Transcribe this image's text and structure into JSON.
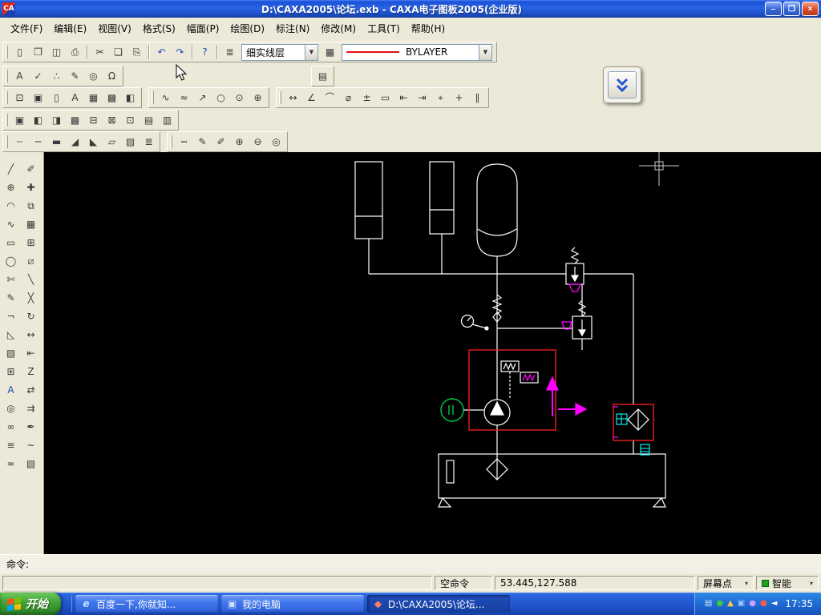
{
  "window": {
    "title": "D:\\CAXA2005\\论坛.exb - CAXA电子图板2005(企业版)",
    "app_initials": "CA"
  },
  "glyphs": {
    "combo_arrow": "▼",
    "dropdown": "▾",
    "minimize": "–",
    "maximize": "❐",
    "close": "×"
  },
  "menu": [
    {
      "id": "file",
      "label": "文件(F)"
    },
    {
      "id": "edit",
      "label": "编辑(E)"
    },
    {
      "id": "view",
      "label": "视图(V)"
    },
    {
      "id": "format",
      "label": "格式(S)"
    },
    {
      "id": "paper",
      "label": "幅面(P)"
    },
    {
      "id": "draw",
      "label": "绘图(D)"
    },
    {
      "id": "dimension",
      "label": "标注(N)"
    },
    {
      "id": "modify",
      "label": "修改(M)"
    },
    {
      "id": "tools",
      "label": "工具(T)"
    },
    {
      "id": "help",
      "label": "帮助(H)"
    }
  ],
  "toolbars": {
    "standard": [
      {
        "n": "new-file",
        "g": "▯"
      },
      {
        "n": "open-file",
        "g": "❐"
      },
      {
        "n": "save-file",
        "g": "◫"
      },
      {
        "n": "print",
        "g": "⎙"
      },
      "|",
      {
        "n": "cut",
        "g": "✂"
      },
      {
        "n": "copy",
        "g": "❏"
      },
      {
        "n": "paste",
        "g": "⎘"
      },
      "|",
      {
        "n": "undo",
        "g": "↶",
        "c": "#2a52c4"
      },
      {
        "n": "redo",
        "g": "↷",
        "c": "#2a52c4"
      },
      "|",
      {
        "n": "help",
        "g": "?",
        "c": "#1a48c4"
      },
      "|",
      {
        "n": "layer-settings",
        "g": "≣"
      }
    ],
    "layer_combo": "细实线层",
    "color_combo": "BYLAYER",
    "row1_extra": [
      {
        "n": "line-width",
        "g": "▦"
      }
    ],
    "row2": [
      {
        "n": "text-style",
        "g": "A"
      },
      {
        "n": "dimension-style",
        "g": "✓"
      },
      {
        "n": "point-style",
        "g": "∴"
      },
      {
        "n": "style-manager",
        "g": "✎"
      },
      {
        "n": "query",
        "g": "◎"
      },
      {
        "n": "symbols",
        "g": "Ω"
      }
    ],
    "row2_single": [
      {
        "n": "options",
        "g": "▤"
      }
    ],
    "view_group": [
      {
        "n": "zoom-window",
        "g": "⊡"
      },
      {
        "n": "show-image",
        "g": "▣"
      },
      {
        "n": "new-view",
        "g": "▯"
      },
      {
        "n": "text-display",
        "g": "A"
      },
      {
        "n": "table",
        "g": "▦"
      },
      {
        "n": "layer-colors",
        "g": "▩"
      },
      {
        "n": "layout",
        "g": "◧"
      }
    ],
    "draw_group": [
      {
        "n": "spline",
        "g": "∿"
      },
      {
        "n": "sketch",
        "g": "≈"
      },
      {
        "n": "leader",
        "g": "↗"
      },
      {
        "n": "circle",
        "g": "○"
      },
      {
        "n": "point",
        "g": "⊙"
      },
      {
        "n": "center-mark",
        "g": "⊕"
      }
    ],
    "dim_group": [
      {
        "n": "dim-linear",
        "g": "↔"
      },
      {
        "n": "dim-angular",
        "g": "∠"
      },
      {
        "n": "dim-arc",
        "g": "⌒"
      },
      {
        "n": "dim-diameter",
        "g": "⌀"
      },
      {
        "n": "dim-tolerance",
        "g": "±"
      },
      {
        "n": "dim-frame",
        "g": "▭"
      },
      {
        "n": "dim-datum-left",
        "g": "⇤"
      },
      {
        "n": "dim-datum-right",
        "g": "⇥"
      },
      {
        "n": "dim-center",
        "g": "⌖"
      },
      {
        "n": "dim-cross",
        "g": "+"
      },
      {
        "n": "dim-parallel",
        "g": "∥"
      }
    ],
    "block_group": [
      {
        "n": "block-create",
        "g": "▣"
      },
      {
        "n": "block-insert",
        "g": "◧"
      },
      {
        "n": "block-attrib",
        "g": "◨"
      },
      {
        "n": "block-library",
        "g": "▩"
      },
      {
        "n": "block-edit",
        "g": "⊟"
      },
      {
        "n": "block-explode",
        "g": "⊠"
      },
      {
        "n": "ole-object",
        "g": "⊡"
      },
      {
        "n": "image-ref",
        "g": "▤"
      },
      {
        "n": "xref",
        "g": "▥"
      }
    ],
    "style_group": [
      {
        "n": "linetype-dash",
        "g": "┄"
      },
      {
        "n": "linetype-solid",
        "g": "─"
      },
      {
        "n": "line-bold",
        "g": "▬"
      },
      {
        "n": "hatch-left",
        "g": "◢"
      },
      {
        "n": "hatch-right",
        "g": "◣"
      },
      {
        "n": "parallelogram",
        "g": "▱"
      },
      {
        "n": "fill-pattern",
        "g": "▨"
      },
      {
        "n": "line-styles",
        "g": "≣"
      }
    ],
    "edit_group": [
      {
        "n": "dotted-line",
        "g": "┉"
      },
      {
        "n": "edit-pen",
        "g": "✎"
      },
      {
        "n": "edit-pencil",
        "g": "✐"
      },
      {
        "n": "zoom-in",
        "g": "⊕"
      },
      {
        "n": "zoom-out",
        "g": "⊖"
      },
      {
        "n": "inspect",
        "g": "◎"
      }
    ]
  },
  "palette": {
    "col1": [
      {
        "n": "draw-line",
        "g": "╱"
      },
      {
        "n": "draw-circle",
        "g": "⊕"
      },
      {
        "n": "draw-arc",
        "g": "◠"
      },
      {
        "n": "draw-spline",
        "g": "∿"
      },
      {
        "n": "draw-rectangle",
        "g": "▭"
      },
      {
        "n": "draw-ellipse",
        "g": "◯"
      },
      {
        "n": "trim",
        "g": "✄"
      },
      {
        "n": "sketch-pen",
        "g": "✎"
      },
      {
        "n": "break-corner",
        "g": "¬"
      },
      {
        "n": "chamfer",
        "g": "◺"
      },
      {
        "n": "hatch",
        "g": "▨"
      },
      {
        "n": "block-text",
        "g": "⊞"
      },
      {
        "n": "text",
        "g": "A",
        "c": "#1a48c4"
      },
      {
        "n": "inspect-zoom",
        "g": "◎"
      },
      {
        "n": "link",
        "g": "∞"
      },
      {
        "n": "object-list",
        "g": "≡"
      },
      {
        "n": "wave-line",
        "g": "≈"
      }
    ],
    "col2": [
      {
        "n": "edit-color",
        "g": "✐"
      },
      {
        "n": "move",
        "g": "✚"
      },
      {
        "n": "mirror",
        "g": "⧉"
      },
      {
        "n": "array",
        "g": "▦"
      },
      {
        "n": "window-select",
        "g": "⊞"
      },
      {
        "n": "crop",
        "g": "⧄"
      },
      {
        "n": "divide",
        "g": "╲"
      },
      {
        "n": "erase",
        "g": "╳"
      },
      {
        "n": "rotate",
        "g": "↻"
      },
      {
        "n": "stretch",
        "g": "↔"
      },
      {
        "n": "align-left",
        "g": "⇤"
      },
      {
        "n": "zigzag",
        "g": "Z"
      },
      {
        "n": "swap",
        "g": "⇄"
      },
      {
        "n": "offset",
        "g": "⇉"
      },
      {
        "n": "pen-style",
        "g": "✒"
      },
      {
        "n": "connector",
        "g": "~"
      },
      {
        "n": "fill",
        "g": "▧"
      }
    ]
  },
  "command": {
    "label": "命令:"
  },
  "status": {
    "mode": "空命令",
    "coords": "53.445,127.588",
    "pick": "屏幕点",
    "snap": "智能"
  },
  "taskbar": {
    "start": "开始",
    "tasks": [
      {
        "label": "百度一下,你就知...",
        "icon": "e",
        "icon_color": "#bfe6ff",
        "active": false
      },
      {
        "label": "我的电脑",
        "icon": "▣",
        "icon_color": "#cfe0ff",
        "active": false
      },
      {
        "label": "D:\\CAXA2005\\论坛...",
        "icon": "◆",
        "icon_color": "#ff7a6a",
        "active": true
      }
    ],
    "tray_icons": [
      {
        "n": "ime",
        "g": "▤",
        "c": "#d8e8ff"
      },
      {
        "n": "antivirus",
        "g": "●",
        "c": "#3ecb3e"
      },
      {
        "n": "update-shield",
        "g": "▲",
        "c": "#ffc83c"
      },
      {
        "n": "network",
        "g": "▣",
        "c": "#9cc8ff"
      },
      {
        "n": "messenger",
        "g": "●",
        "c": "#c9a0ff"
      },
      {
        "n": "alert",
        "g": "●",
        "c": "#ff5a48"
      },
      {
        "n": "volume",
        "g": "◄",
        "c": "#ffffff"
      }
    ],
    "time": "17:35"
  }
}
